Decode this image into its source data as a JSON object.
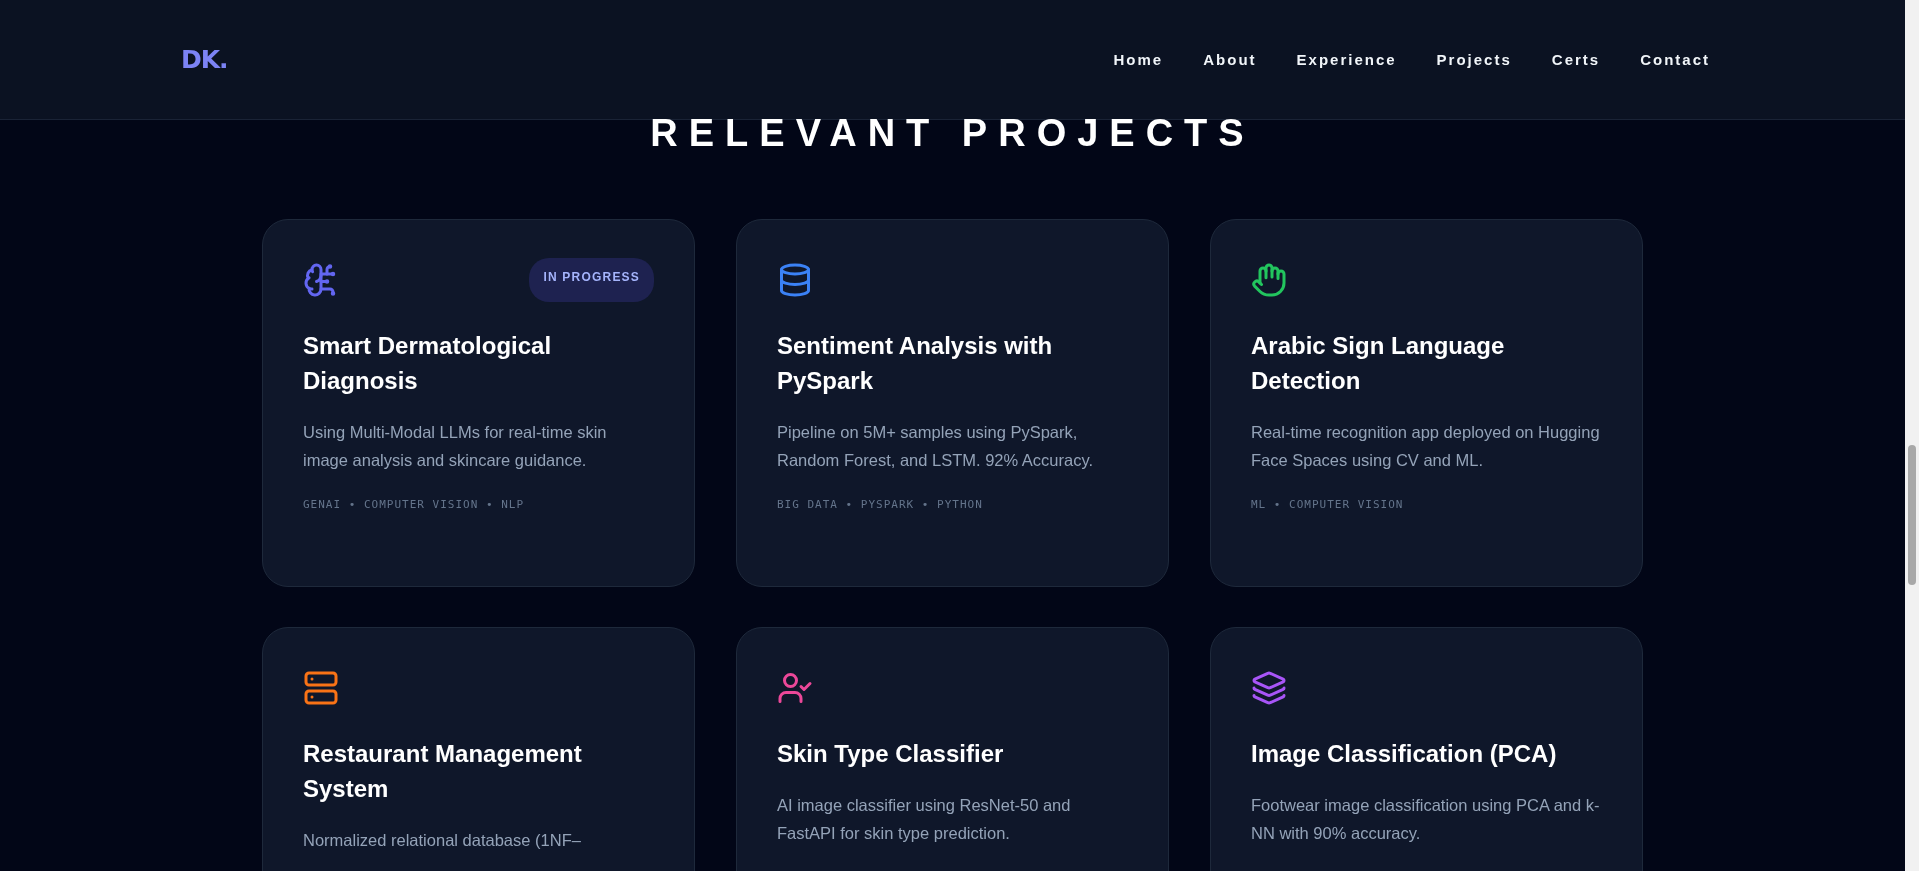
{
  "logo": "DK.",
  "nav": [
    "Home",
    "About",
    "Experience",
    "Projects",
    "Certs",
    "Contact"
  ],
  "section_title": "RELEVANT PROJECTS",
  "projects": [
    {
      "kind": "brain",
      "color": "#6366f1",
      "badge": "IN PROGRESS",
      "title": "Smart Dermatological Diagnosis",
      "description": "Using Multi-Modal LLMs for real-time skin image analysis and skincare guidance.",
      "tags": "GENAI • COMPUTER VISION • NLP"
    },
    {
      "kind": "database",
      "color": "#3b82f6",
      "title": "Sentiment Analysis with PySpark",
      "description": "Pipeline on 5M+ samples using PySpark, Random Forest, and LSTM. 92% Accuracy.",
      "tags": "BIG DATA • PYSPARK • PYTHON"
    },
    {
      "kind": "hand",
      "color": "#22c55e",
      "title": "Arabic Sign Language Detection",
      "description": "Real-time recognition app deployed on Hugging Face Spaces using CV and ML.",
      "tags": "ML • COMPUTER VISION"
    },
    {
      "kind": "server",
      "color": "#f97316",
      "title": "Restaurant Management System",
      "description": "Normalized relational database (1NF–"
    },
    {
      "kind": "usercheck",
      "color": "#ec4899",
      "title": "Skin Type Classifier",
      "description": "AI image classifier using ResNet-50 and FastAPI for skin type prediction."
    },
    {
      "kind": "layers",
      "color": "#a855f7",
      "title": "Image Classification (PCA)",
      "description": "Footwear image classification using PCA and k-NN with 90% accuracy."
    }
  ]
}
